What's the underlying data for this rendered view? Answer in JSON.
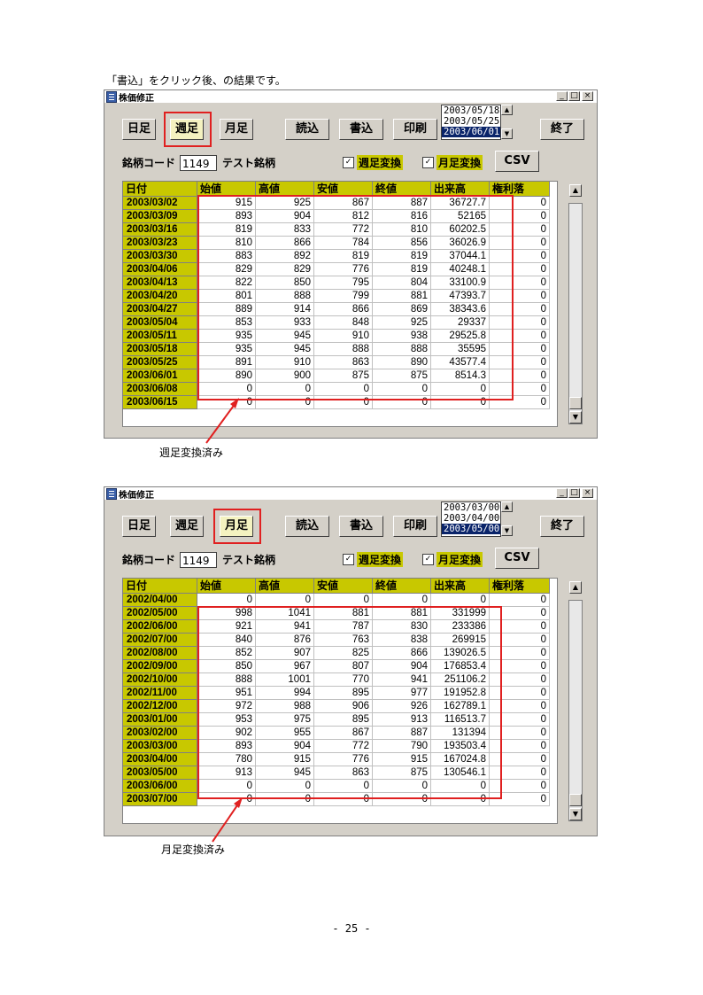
{
  "caption": "「書込」をクリック後、の結果です。",
  "window_title": "株価修正",
  "buttons": {
    "daily": "日足",
    "weekly": "週足",
    "monthly": "月足",
    "read": "読込",
    "write": "書込",
    "print": "印刷",
    "exit": "終了",
    "csv": "CSV"
  },
  "code_label": "銘柄コード",
  "code_value": "1149",
  "stock_name": "テスト銘柄",
  "check_weekly": "週足変換",
  "check_monthly": "月足変換",
  "columns": [
    "日付",
    "始値",
    "高値",
    "安値",
    "終値",
    "出来高",
    "権利落"
  ],
  "win1": {
    "dates": [
      "2003/05/18",
      "2003/05/25",
      "2003/06/01"
    ],
    "rows": [
      [
        "2003/03/02",
        "915",
        "925",
        "867",
        "887",
        "36727.7",
        "0"
      ],
      [
        "2003/03/09",
        "893",
        "904",
        "812",
        "816",
        "52165",
        "0"
      ],
      [
        "2003/03/16",
        "819",
        "833",
        "772",
        "810",
        "60202.5",
        "0"
      ],
      [
        "2003/03/23",
        "810",
        "866",
        "784",
        "856",
        "36026.9",
        "0"
      ],
      [
        "2003/03/30",
        "883",
        "892",
        "819",
        "819",
        "37044.1",
        "0"
      ],
      [
        "2003/04/06",
        "829",
        "829",
        "776",
        "819",
        "40248.1",
        "0"
      ],
      [
        "2003/04/13",
        "822",
        "850",
        "795",
        "804",
        "33100.9",
        "0"
      ],
      [
        "2003/04/20",
        "801",
        "888",
        "799",
        "881",
        "47393.7",
        "0"
      ],
      [
        "2003/04/27",
        "889",
        "914",
        "866",
        "869",
        "38343.6",
        "0"
      ],
      [
        "2003/05/04",
        "853",
        "933",
        "848",
        "925",
        "29337",
        "0"
      ],
      [
        "2003/05/11",
        "935",
        "945",
        "910",
        "938",
        "29525.8",
        "0"
      ],
      [
        "2003/05/18",
        "935",
        "945",
        "888",
        "888",
        "35595",
        "0"
      ],
      [
        "2003/05/25",
        "891",
        "910",
        "863",
        "890",
        "43577.4",
        "0"
      ],
      [
        "2003/06/01",
        "890",
        "900",
        "875",
        "875",
        "8514.3",
        "0"
      ],
      [
        "2003/06/08",
        "0",
        "0",
        "0",
        "0",
        "0",
        "0"
      ],
      [
        "2003/06/15",
        "0",
        "0",
        "0",
        "0",
        "0",
        "0"
      ]
    ],
    "note": "週足変換済み"
  },
  "win2": {
    "dates": [
      "2003/03/00",
      "2003/04/00",
      "2003/05/00"
    ],
    "rows": [
      [
        "2002/04/00",
        "0",
        "0",
        "0",
        "0",
        "0",
        "0"
      ],
      [
        "2002/05/00",
        "998",
        "1041",
        "881",
        "881",
        "331999",
        "0"
      ],
      [
        "2002/06/00",
        "921",
        "941",
        "787",
        "830",
        "233386",
        "0"
      ],
      [
        "2002/07/00",
        "840",
        "876",
        "763",
        "838",
        "269915",
        "0"
      ],
      [
        "2002/08/00",
        "852",
        "907",
        "825",
        "866",
        "139026.5",
        "0"
      ],
      [
        "2002/09/00",
        "850",
        "967",
        "807",
        "904",
        "176853.4",
        "0"
      ],
      [
        "2002/10/00",
        "888",
        "1001",
        "770",
        "941",
        "251106.2",
        "0"
      ],
      [
        "2002/11/00",
        "951",
        "994",
        "895",
        "977",
        "191952.8",
        "0"
      ],
      [
        "2002/12/00",
        "972",
        "988",
        "906",
        "926",
        "162789.1",
        "0"
      ],
      [
        "2003/01/00",
        "953",
        "975",
        "895",
        "913",
        "116513.7",
        "0"
      ],
      [
        "2003/02/00",
        "902",
        "955",
        "867",
        "887",
        "131394",
        "0"
      ],
      [
        "2003/03/00",
        "893",
        "904",
        "772",
        "790",
        "193503.4",
        "0"
      ],
      [
        "2003/04/00",
        "780",
        "915",
        "776",
        "915",
        "167024.8",
        "0"
      ],
      [
        "2003/05/00",
        "913",
        "945",
        "863",
        "875",
        "130546.1",
        "0"
      ],
      [
        "2003/06/00",
        "0",
        "0",
        "0",
        "0",
        "0",
        "0"
      ],
      [
        "2003/07/00",
        "0",
        "0",
        "0",
        "0",
        "0",
        "0"
      ]
    ],
    "note": "月足変換済み"
  },
  "page_number": "- 25 -",
  "colors": {
    "accent": "#e02020",
    "header": "#c8c800",
    "selection": "#0a246a"
  }
}
